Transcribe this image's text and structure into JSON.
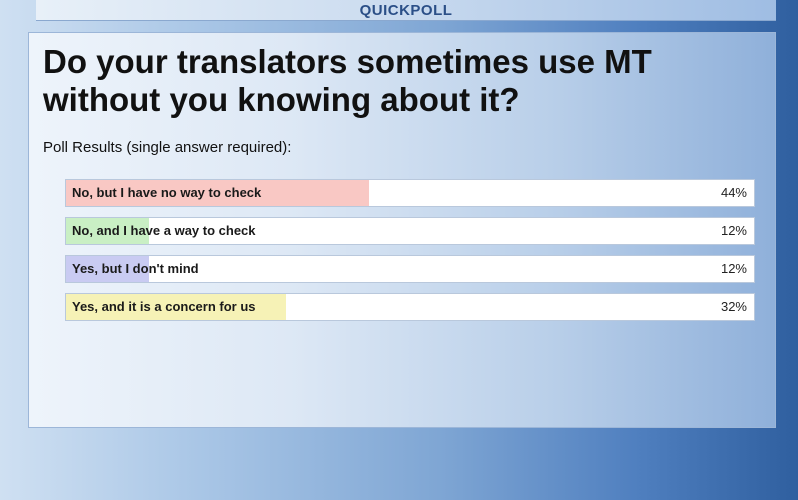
{
  "header": {
    "title": "QUICKPOLL"
  },
  "poll": {
    "question": "Do your translators sometimes use MT without you knowing about it?",
    "subtitle": "Poll Results (single answer required):",
    "results": [
      {
        "label": "No, but I have no way to check",
        "percent_text": "44%",
        "percent": 44,
        "color": "#f9c8c4"
      },
      {
        "label": "No, and I have a way to check",
        "percent_text": "12%",
        "percent": 12,
        "color": "#c9efc4"
      },
      {
        "label": "Yes, but I don't mind",
        "percent_text": "12%",
        "percent": 12,
        "color": "#c9cbf2"
      },
      {
        "label": "Yes, and it is a concern for us",
        "percent_text": "32%",
        "percent": 32,
        "color": "#f6f2b6"
      }
    ]
  }
}
